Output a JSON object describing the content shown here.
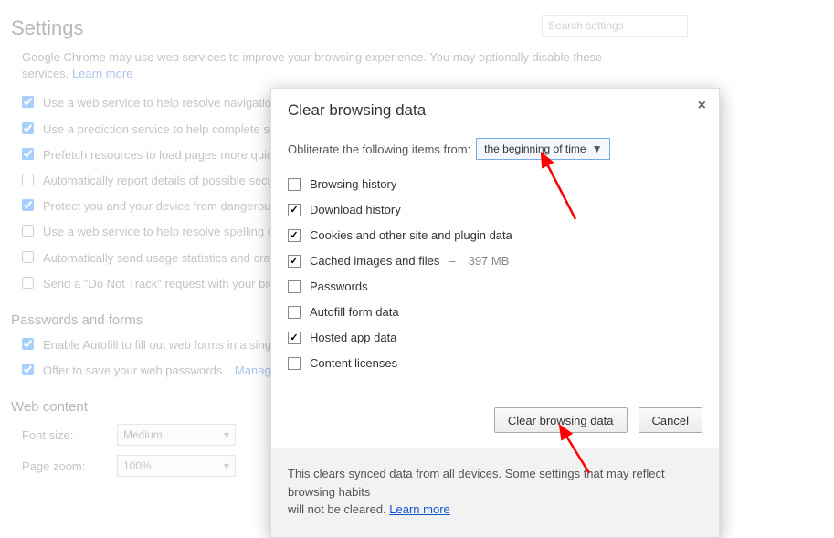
{
  "page": {
    "title": "Settings",
    "search_placeholder": "Search settings",
    "intro_a": "Google Chrome may use web services to improve your browsing experience. You may optionally disable these",
    "intro_b": "services. ",
    "intro_link": "Learn more",
    "privacy_opts": [
      {
        "label": "Use a web service to help resolve navigation errors",
        "checked": true
      },
      {
        "label": "Use a prediction service to help complete searches and URLs typed in the address bar or the app launcher search box",
        "checked": true
      },
      {
        "label": "Prefetch resources to load pages more quickly",
        "checked": true
      },
      {
        "label": "Automatically report details of possible security incidents to Google",
        "checked": false
      },
      {
        "label": "Protect you and your device from dangerous sites",
        "checked": true
      },
      {
        "label": "Use a web service to help resolve spelling errors",
        "checked": false
      },
      {
        "label": "Automatically send usage statistics and crash reports to Google",
        "checked": false
      },
      {
        "label": "Send a \"Do Not Track\" request with your browsing traffic",
        "checked": false
      }
    ],
    "section_passwords": "Passwords and forms",
    "pass_opts": [
      {
        "label": "Enable Autofill to fill out web forms in a single click.",
        "checked": true,
        "link": ""
      },
      {
        "label": "Offer to save your web passwords. ",
        "checked": true,
        "link": "Manage passwords"
      }
    ],
    "section_web": "Web content",
    "font_label": "Font size:",
    "font_value": "Medium",
    "zoom_label": "Page zoom:",
    "zoom_value": "100%"
  },
  "dialog": {
    "title": "Clear browsing data",
    "obliterate_label": "Obliterate the following items from:",
    "time_range": "the beginning of time",
    "items": [
      {
        "label": "Browsing history",
        "checked": false
      },
      {
        "label": "Download history",
        "checked": true
      },
      {
        "label": "Cookies and other site and plugin data",
        "checked": true
      },
      {
        "label": "Cached images and files",
        "checked": true,
        "size": "397 MB"
      },
      {
        "label": "Passwords",
        "checked": false
      },
      {
        "label": "Autofill form data",
        "checked": false
      },
      {
        "label": "Hosted app data",
        "checked": true
      },
      {
        "label": "Content licenses",
        "checked": false
      }
    ],
    "primary_btn": "Clear browsing data",
    "cancel_btn": "Cancel",
    "footer_a": "This clears synced data from all devices. Some settings that may reflect browsing habits",
    "footer_b": "will not be cleared. ",
    "footer_link": "Learn more"
  }
}
